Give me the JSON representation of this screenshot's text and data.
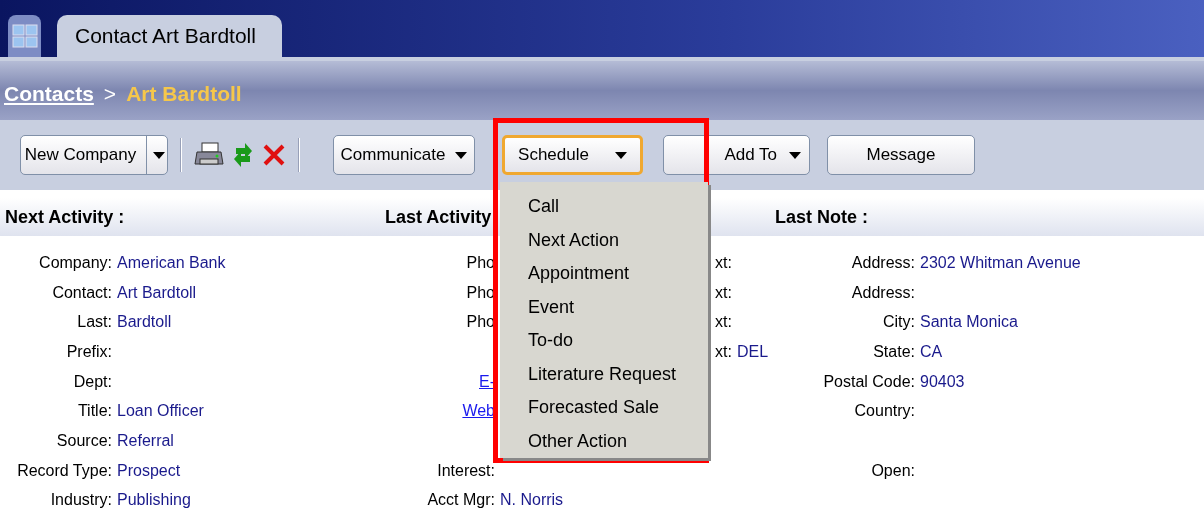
{
  "tabs": [
    {
      "label": "Contact Art Bardtoll",
      "selected": true
    }
  ],
  "breadcrumb": {
    "separator": ">",
    "items": [
      {
        "label": "Contacts",
        "kind": "link"
      },
      {
        "label": "Art Bardtoll",
        "kind": "current"
      }
    ]
  },
  "toolbar": {
    "buttons": [
      {
        "label": "New Company",
        "kind": "split",
        "selected": false
      },
      {
        "label": "Communicate",
        "kind": "dropdown",
        "selected": false
      },
      {
        "label": "Schedule",
        "kind": "dropdown",
        "selected": true
      },
      {
        "label": "Add To",
        "kind": "dropdown",
        "selected": false
      },
      {
        "label": "Message",
        "kind": "plain",
        "selected": false
      }
    ]
  },
  "schedule_menu": {
    "items": [
      "Call",
      "Next Action",
      "Appointment",
      "Event",
      "To-do",
      "Literature Request",
      "Forecasted Sale",
      "Other Action"
    ]
  },
  "headers": [
    "Next Activity :",
    "Last Activity",
    "Last Note :"
  ],
  "rows": [
    {
      "left": {
        "label": "Company:",
        "value": "American Bank"
      },
      "middle": {
        "label": "Pho"
      },
      "ext": {
        "label": "xt:"
      },
      "right": {
        "label": "Address:",
        "value": "2302 Whitman Avenue"
      }
    },
    {
      "left": {
        "label": "Contact:",
        "value": "Art Bardtoll"
      },
      "middle": {
        "label": "Pho"
      },
      "ext": {
        "label": "xt:"
      },
      "right": {
        "label": "Address:"
      }
    },
    {
      "left": {
        "label": "Last:",
        "value": "Bardtoll"
      },
      "middle": {
        "label": "Pho"
      },
      "ext": {
        "label": "xt:"
      },
      "right": {
        "label": "City:",
        "value": "Santa Monica"
      }
    },
    {
      "left": {
        "label": "Prefix:"
      },
      "ext": {
        "label": "xt:",
        "value": "DEL"
      },
      "right": {
        "label": "State:",
        "value": "CA"
      }
    },
    {
      "left": {
        "label": "Dept:"
      },
      "middle": {
        "link": "E-"
      },
      "right": {
        "label": "Postal Code:",
        "value": "90403"
      }
    },
    {
      "left": {
        "label": "Title:",
        "value": "Loan Officer"
      },
      "middle": {
        "link": "Web"
      },
      "right": {
        "label": "Country:"
      }
    },
    {
      "left": {
        "label": "Source:",
        "value": "Referral"
      }
    },
    {
      "left": {
        "label": "Record Type:",
        "value": "Prospect"
      },
      "middle": {
        "label": "Interest:"
      },
      "right": {
        "label": "Open:"
      }
    },
    {
      "left": {
        "label": "Industry:",
        "value": "Publishing"
      },
      "middle": {
        "label": "Acct Mgr:",
        "value": "N. Norris"
      }
    }
  ]
}
